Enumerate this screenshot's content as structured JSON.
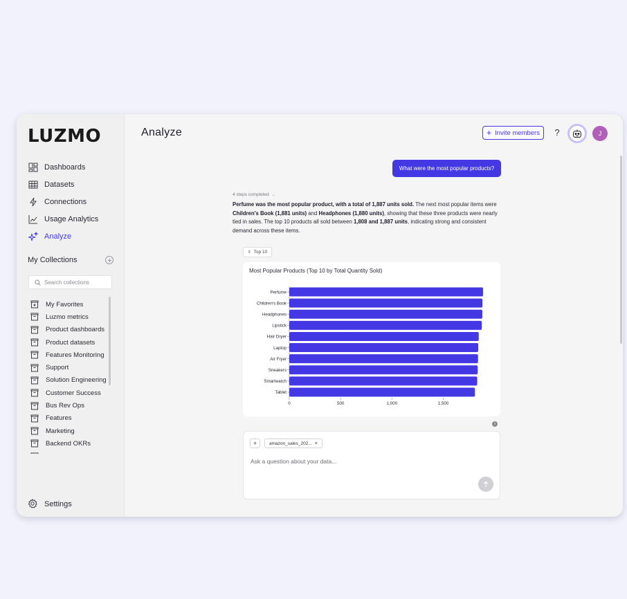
{
  "app": {
    "logo": "LUZMO",
    "page_title": "Analyze"
  },
  "sidebar": {
    "nav": [
      {
        "label": "Dashboards",
        "icon": "dashboard-icon"
      },
      {
        "label": "Datasets",
        "icon": "table-icon"
      },
      {
        "label": "Connections",
        "icon": "plug-icon"
      },
      {
        "label": "Usage Analytics",
        "icon": "trend-icon"
      },
      {
        "label": "Analyze",
        "icon": "sparkle-icon",
        "active": true
      }
    ],
    "collections_title": "My Collections",
    "search_placeholder": "Search collections",
    "collections": [
      "My Favorites",
      "Luzmo metrics",
      "Product dashboards",
      "Product datasets",
      "Features Monitoring",
      "Support",
      "Solution Engineering",
      "Customer Success",
      "Bus Rev Ops",
      "Features",
      "Marketing",
      "Backend OKRs",
      ""
    ],
    "settings": "Settings"
  },
  "header": {
    "invite_label": "Invite members",
    "help": "?",
    "user_initial": "J"
  },
  "chat": {
    "question": "What were the most popular products?",
    "steps": "4 steps completed",
    "answer_parts": [
      {
        "t": "Perfume was the most popular product, with a total of 1,887 units sold.",
        "b": true
      },
      {
        "t": " The next most popular items were ",
        "b": false
      },
      {
        "t": "Children's Book (1,881 units)",
        "b": true
      },
      {
        "t": " and ",
        "b": false
      },
      {
        "t": "Headphones (1,880 units)",
        "b": true
      },
      {
        "t": ", showing that these three products were nearly tied in sales. The top 10 products all sold between ",
        "b": false
      },
      {
        "t": "1,808 and 1,887 units",
        "b": true
      },
      {
        "t": ", indicating strong and consistent demand across these items.",
        "b": false
      }
    ],
    "top_chip": "Top 10",
    "input_placeholder": "Ask a question about your data...",
    "dataset_chip": "amazon_sales_202...",
    "info": "i"
  },
  "chart_data": {
    "type": "bar",
    "orientation": "horizontal",
    "title": "Most Popular Products (Top 10 by Total Quantity Sold)",
    "categories": [
      "Perfume",
      "Children's Book",
      "Headphones",
      "Lipstick",
      "Hair Dryer",
      "Laptop",
      "Air Fryer",
      "Sneakers",
      "Smartwatch",
      "Tablet"
    ],
    "values": [
      1887,
      1881,
      1880,
      1875,
      1845,
      1840,
      1838,
      1835,
      1830,
      1808
    ],
    "xlim": [
      0,
      1887
    ],
    "xticks": [
      0,
      500,
      1000,
      1500
    ],
    "xtick_labels": [
      "0",
      "500",
      "1,000",
      "1,500"
    ],
    "bar_color": "#4438e5",
    "grid": false
  },
  "colors": {
    "accent": "#4438e5",
    "avatar": "#b15fb8",
    "frame_bg": "#f5f5f5",
    "page_bg": "#f1f2fb"
  }
}
